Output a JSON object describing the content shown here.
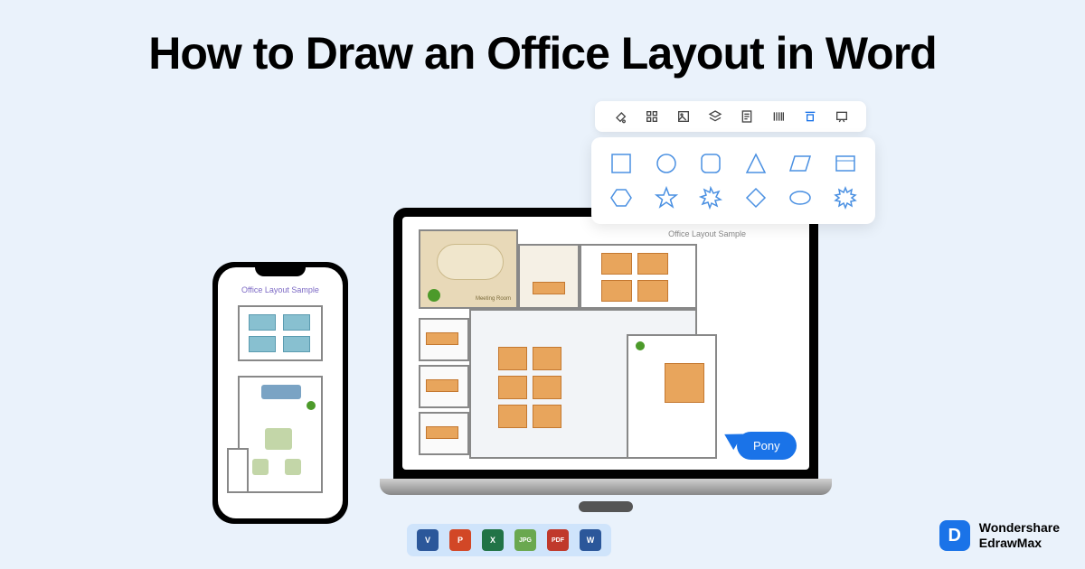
{
  "title": "How to Draw an Office Layout in Word",
  "laptop": {
    "canvas_title": "Office Layout Sample",
    "room_label": "Meeting Room"
  },
  "phone": {
    "canvas_title": "Office Layout Sample"
  },
  "toolbar": {
    "icons": [
      "fill-icon",
      "grid-icon",
      "image-icon",
      "layers-icon",
      "document-icon",
      "barcode-icon",
      "align-icon",
      "present-icon"
    ],
    "active_index": 6
  },
  "shapes": {
    "row1": [
      "square",
      "circle",
      "rounded-square",
      "triangle",
      "parallelogram",
      "flip-rect"
    ],
    "row2": [
      "hexagon",
      "star",
      "burst-8",
      "diamond",
      "ellipse",
      "burst-12"
    ]
  },
  "cursor": {
    "user_label": "Pony"
  },
  "export": {
    "formats": [
      {
        "name": "visio",
        "label": "V",
        "color": "#2b579a"
      },
      {
        "name": "powerpoint",
        "label": "P",
        "color": "#d24726"
      },
      {
        "name": "excel",
        "label": "X",
        "color": "#217346"
      },
      {
        "name": "jpg",
        "label": "JPG",
        "color": "#6aa84f"
      },
      {
        "name": "pdf",
        "label": "PDF",
        "color": "#c0392b"
      },
      {
        "name": "word",
        "label": "W",
        "color": "#2b579a"
      }
    ]
  },
  "brand": {
    "logo_letter": "D",
    "name_line1": "Wondershare",
    "name_line2": "EdrawMax"
  }
}
